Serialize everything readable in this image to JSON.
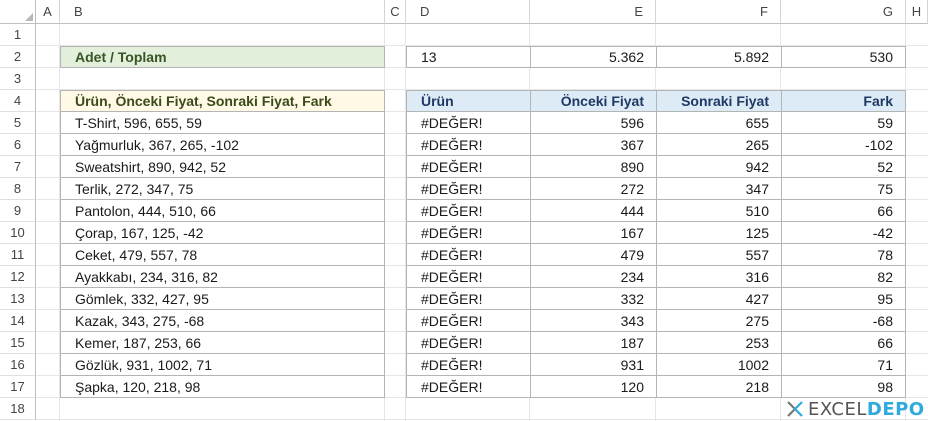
{
  "columns": [
    "A",
    "B",
    "C",
    "D",
    "E",
    "F",
    "G",
    "H"
  ],
  "rows": [
    "1",
    "2",
    "3",
    "4",
    "5",
    "6",
    "7",
    "8",
    "9",
    "10",
    "11",
    "12",
    "13",
    "14",
    "15",
    "16",
    "17",
    "18"
  ],
  "summary": {
    "label": "Adet / Toplam",
    "count": "13",
    "prev_total": "5.362",
    "next_total": "5.892",
    "diff_total": "530"
  },
  "source_header": "Ürün, Önceki Fiyat, Sonraki Fiyat, Fark",
  "source_rows": [
    "T-Shirt, 596, 655, 59",
    "Yağmurluk, 367, 265, -102",
    "Sweatshirt, 890, 942, 52",
    "Terlik, 272, 347, 75",
    "Pantolon, 444, 510, 66",
    "Çorap, 167, 125, -42",
    "Ceket, 479, 557, 78",
    "Ayakkabı, 234, 316, 82",
    "Gömlek, 332, 427, 95",
    "Kazak, 343, 275, -68",
    "Kemer, 187, 253, 66",
    "Gözlük, 931, 1002, 71",
    "Şapka, 120, 218, 98"
  ],
  "table_headers": [
    "Ürün",
    "Önceki Fiyat",
    "Sonraki Fiyat",
    "Fark"
  ],
  "table_rows": [
    [
      "#DEĞER!",
      "596",
      "655",
      "59"
    ],
    [
      "#DEĞER!",
      "367",
      "265",
      "-102"
    ],
    [
      "#DEĞER!",
      "890",
      "942",
      "52"
    ],
    [
      "#DEĞER!",
      "272",
      "347",
      "75"
    ],
    [
      "#DEĞER!",
      "444",
      "510",
      "66"
    ],
    [
      "#DEĞER!",
      "167",
      "125",
      "-42"
    ],
    [
      "#DEĞER!",
      "479",
      "557",
      "78"
    ],
    [
      "#DEĞER!",
      "234",
      "316",
      "82"
    ],
    [
      "#DEĞER!",
      "332",
      "427",
      "95"
    ],
    [
      "#DEĞER!",
      "343",
      "275",
      "-68"
    ],
    [
      "#DEĞER!",
      "187",
      "253",
      "66"
    ],
    [
      "#DEĞER!",
      "931",
      "1002",
      "71"
    ],
    [
      "#DEĞER!",
      "120",
      "218",
      "98"
    ]
  ],
  "logo": {
    "part1": "EXCEL",
    "part2": "DEPO"
  },
  "colors": {
    "green_header": "#e2efda",
    "yellow_header": "#fff9e6",
    "blue_header": "#ddebf7",
    "logo_accent": "#2eaadc"
  }
}
